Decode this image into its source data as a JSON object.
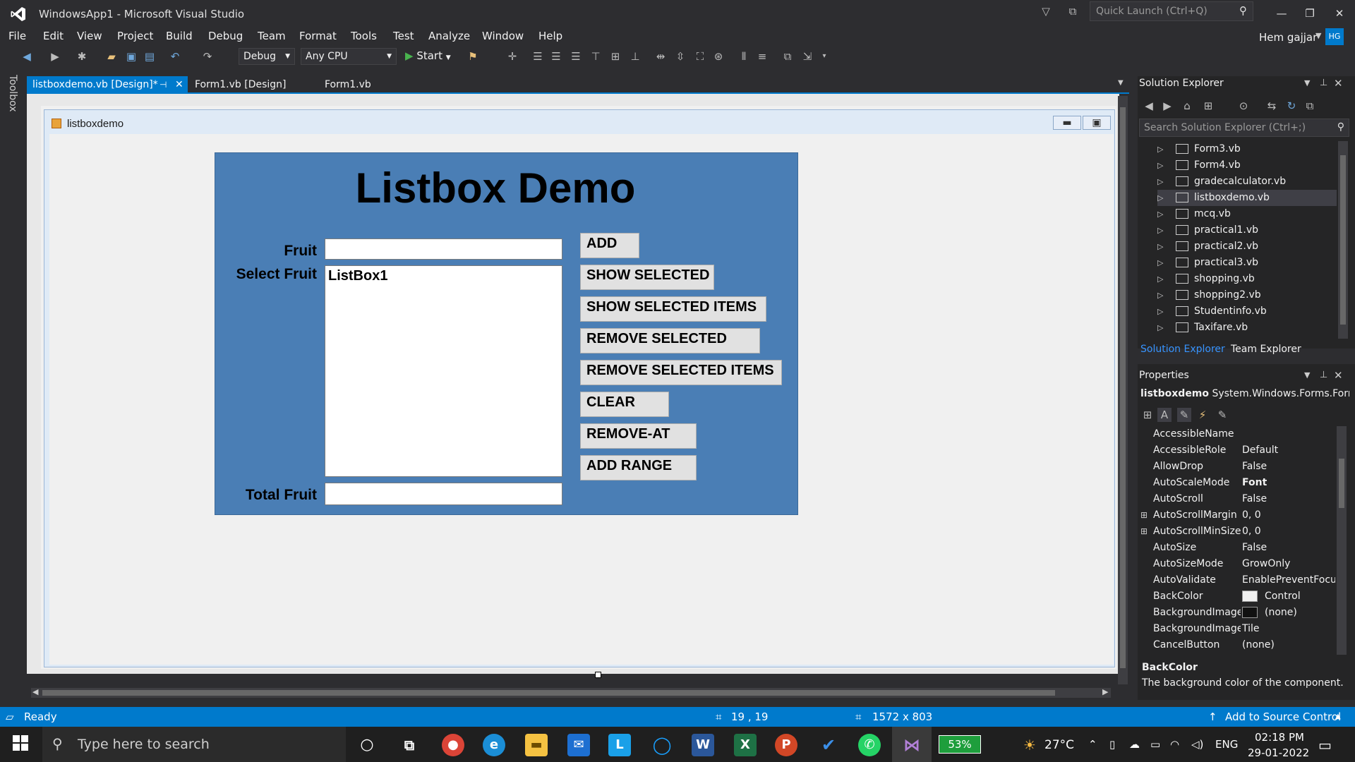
{
  "window": {
    "title": "WindowsApp1 - Microsoft Visual Studio",
    "quick_launch_placeholder": "Quick Launch (Ctrl+Q)",
    "user_name": "Hem gajjar",
    "user_initials": "HG"
  },
  "menu": [
    "File",
    "Edit",
    "View",
    "Project",
    "Build",
    "Debug",
    "Team",
    "Format",
    "Tools",
    "Test",
    "Analyze",
    "Window",
    "Help"
  ],
  "toolbar": {
    "configuration": "Debug",
    "platform": "Any CPU",
    "start_label": "Start"
  },
  "toolbox_label": "Toolbox",
  "tabs": [
    {
      "label": "listboxdemo.vb [Design]*",
      "active": true
    },
    {
      "label": "Form1.vb [Design]",
      "active": false
    },
    {
      "label": "Form1.vb",
      "active": false
    }
  ],
  "designer": {
    "form_caption": "listboxdemo",
    "title": "Listbox Demo",
    "labels": {
      "fruit": "Fruit",
      "select_fruit": "Select Fruit",
      "total_fruit": "Total Fruit"
    },
    "listbox_name": "ListBox1",
    "buttons": [
      "ADD",
      "SHOW SELECTED",
      "SHOW SELECTED ITEMS",
      "REMOVE SELECTED",
      "REMOVE SELECTED ITEMS",
      "CLEAR",
      "REMOVE-AT",
      "ADD RANGE"
    ]
  },
  "solution_explorer": {
    "title": "Solution Explorer",
    "search_placeholder": "Search Solution Explorer (Ctrl+;)",
    "items": [
      "Form3.vb",
      "Form4.vb",
      "gradecalculator.vb",
      "listboxdemo.vb",
      "mcq.vb",
      "practical1.vb",
      "practical2.vb",
      "practical3.vb",
      "shopping.vb",
      "shopping2.vb",
      "Studentinfo.vb",
      "Taxifare.vb"
    ],
    "selected_item": "listboxdemo.vb",
    "bottom_tabs": [
      "Solution Explorer",
      "Team Explorer"
    ]
  },
  "properties": {
    "title": "Properties",
    "object_name": "listboxdemo",
    "object_type": "System.Windows.Forms.Forr",
    "rows": [
      {
        "name": "AccessibleName",
        "value": ""
      },
      {
        "name": "AccessibleRole",
        "value": "Default"
      },
      {
        "name": "AllowDrop",
        "value": "False"
      },
      {
        "name": "AutoScaleMode",
        "value": "Font"
      },
      {
        "name": "AutoScroll",
        "value": "False"
      },
      {
        "name": "AutoScrollMargin",
        "value": "0, 0"
      },
      {
        "name": "AutoScrollMinSize",
        "value": "0, 0"
      },
      {
        "name": "AutoSize",
        "value": "False"
      },
      {
        "name": "AutoSizeMode",
        "value": "GrowOnly"
      },
      {
        "name": "AutoValidate",
        "value": "EnablePreventFocus"
      },
      {
        "name": "BackColor",
        "value": "Control"
      },
      {
        "name": "BackgroundImage",
        "value": "(none)"
      },
      {
        "name": "BackgroundImage",
        "value": "Tile"
      },
      {
        "name": "CancelButton",
        "value": "(none)"
      }
    ],
    "desc_title": "BackColor",
    "desc_text": "The background color of the component."
  },
  "statusbar": {
    "state": "Ready",
    "position": "19 , 19",
    "size": "1572 x 803",
    "source_control": "Add to Source Control"
  },
  "taskbar": {
    "search_placeholder": "Type here to search",
    "battery": "53%",
    "weather": "27°C",
    "language": "ENG",
    "time": "02:18 PM",
    "date": "29-01-2022"
  },
  "colors": {
    "accent": "#007acc",
    "panel_blue": "#4a7eb5",
    "ide_background": "#2d2d30"
  }
}
